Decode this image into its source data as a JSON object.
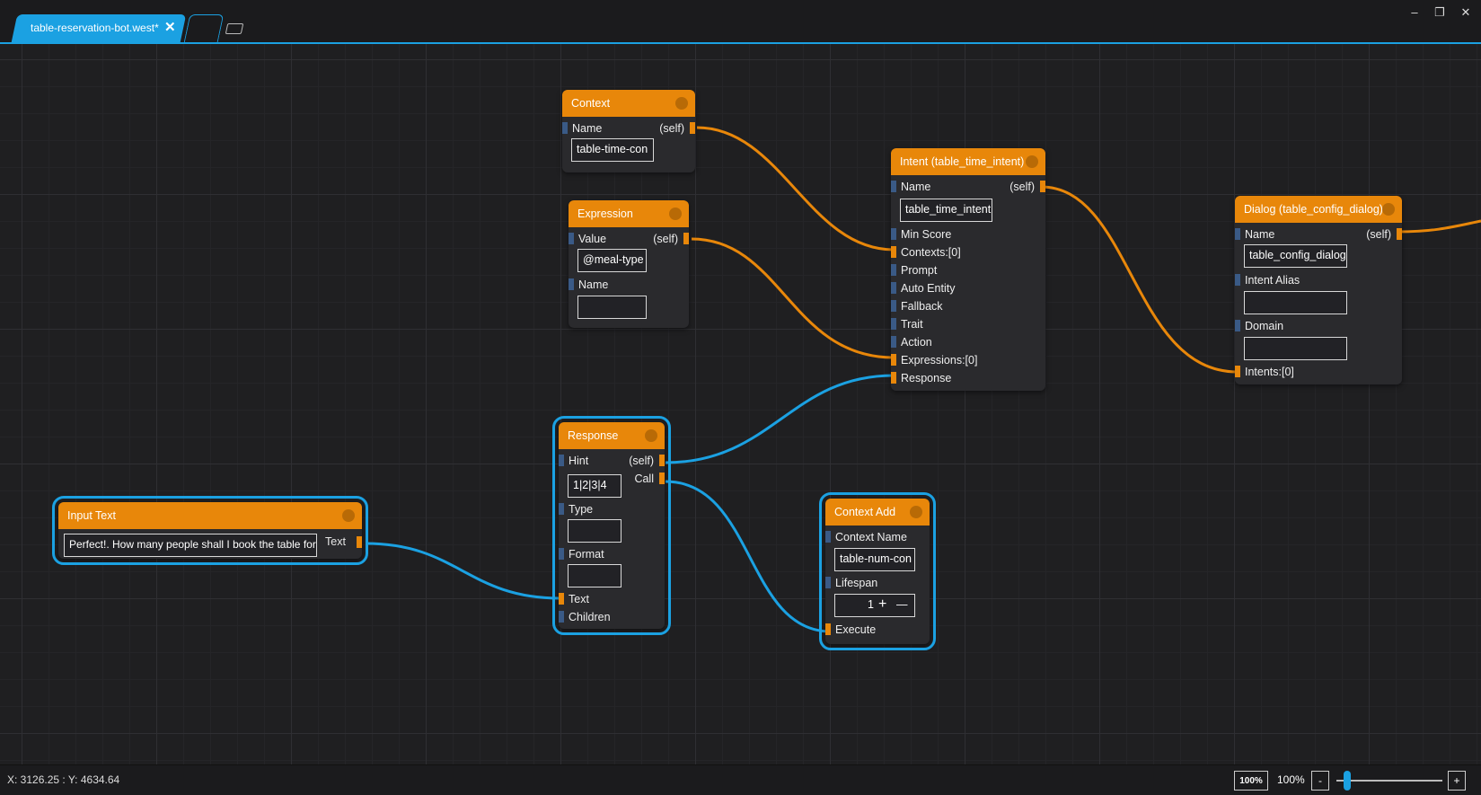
{
  "tabs": {
    "active_title": "table-reservation-bot.west*",
    "close_glyph": "✕"
  },
  "window_controls": {
    "minimize": "‒",
    "restore": "❐",
    "close": "✕"
  },
  "nodes": {
    "context": {
      "title": "Context",
      "name_label": "Name",
      "self_label": "(self)",
      "name_value": "table-time-con"
    },
    "expression": {
      "title": "Expression",
      "value_label": "Value",
      "self_label": "(self)",
      "value_value": "@meal-type",
      "name_label": "Name",
      "name_value": ""
    },
    "intent": {
      "title": "Intent (table_time_intent)",
      "name_label": "Name",
      "self_label": "(self)",
      "name_value": "table_time_intent",
      "fields": [
        "Min Score",
        "Contexts:[0]",
        "Prompt",
        "Auto Entity",
        "Fallback",
        "Trait",
        "Action",
        "Expressions:[0]",
        "Response"
      ]
    },
    "dialog": {
      "title": "Dialog (table_config_dialog)",
      "name_label": "Name",
      "self_label": "(self)",
      "name_value": "table_config_dialog",
      "intent_alias_label": "Intent Alias",
      "intent_alias_value": "",
      "domain_label": "Domain",
      "domain_value": "",
      "intents_label": "Intents:[0]"
    },
    "response": {
      "title": "Response",
      "hint_label": "Hint",
      "self_label": "(self)",
      "call_label": "Call",
      "hint_value": "1|2|3|4",
      "type_label": "Type",
      "type_value": "",
      "format_label": "Format",
      "format_value": "",
      "text_label": "Text",
      "children_label": "Children"
    },
    "input_text": {
      "title": "Input Text",
      "text_value": "Perfect!. How many people shall I book the table for?",
      "text_label": "Text"
    },
    "context_add": {
      "title": "Context Add",
      "context_name_label": "Context Name",
      "context_name_value": "table-num-con",
      "lifespan_label": "Lifespan",
      "lifespan_value": "1",
      "plus_glyph": "+",
      "minus_glyph": "—",
      "execute_label": "Execute"
    }
  },
  "status": {
    "coordinates": "X: 3126.25 : Y: 4634.64",
    "zoom_button": "100%",
    "zoom_label": "100%",
    "zoom_minus": "-",
    "zoom_plus": "+",
    "zoom_level_fraction": 0.1
  },
  "colors": {
    "accent": "#1ba1e2",
    "node_header": "#e8870a",
    "background": "#1f1f21"
  }
}
